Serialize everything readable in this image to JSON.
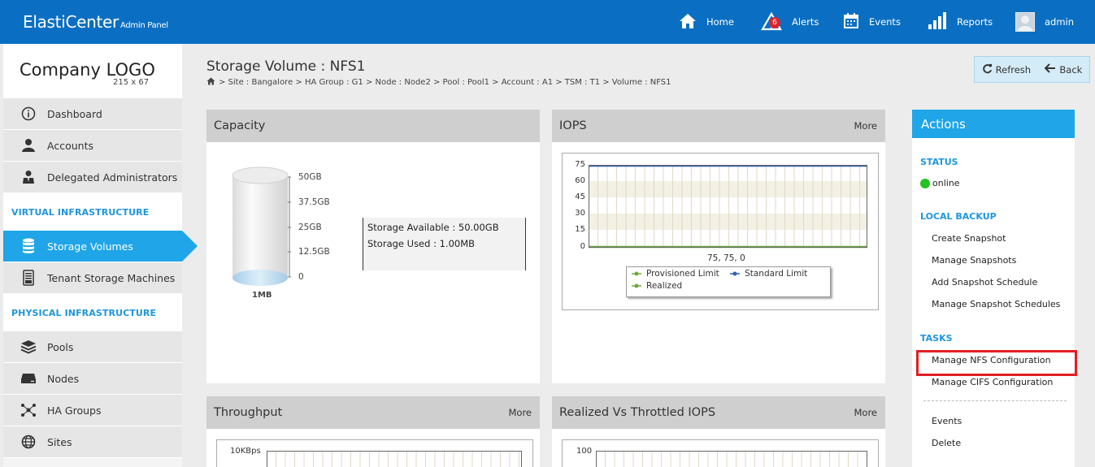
{
  "header": {
    "brand": "ElastiCenter",
    "brand_sub": "Admin Panel",
    "nav": [
      {
        "label": "Home",
        "icon": "home-icon"
      },
      {
        "label": "Alerts",
        "icon": "alert-icon",
        "badge": "6"
      },
      {
        "label": "Events",
        "icon": "calendar-icon"
      },
      {
        "label": "Reports",
        "icon": "bar-chart-icon"
      },
      {
        "label": "admin",
        "icon": "avatar"
      }
    ]
  },
  "sidebar": {
    "logo_line1": "Company LOGO",
    "logo_line2": "215 x 67",
    "items_top": [
      {
        "label": "Dashboard"
      },
      {
        "label": "Accounts"
      },
      {
        "label": "Delegated Administrators"
      }
    ],
    "section_virtual": "VIRTUAL INFRASTRUCTURE",
    "items_virtual": [
      {
        "label": "Storage Volumes",
        "active": true
      },
      {
        "label": "Tenant Storage Machines"
      }
    ],
    "section_physical": "PHYSICAL INFRASTRUCTURE",
    "items_physical": [
      {
        "label": "Pools"
      },
      {
        "label": "Nodes"
      },
      {
        "label": "HA Groups"
      },
      {
        "label": "Sites"
      }
    ]
  },
  "page": {
    "title": "Storage Volume : NFS1",
    "breadcrumb": "> Site : Bangalore > HA Group : G1 > Node : Node2 > Pool : Pool1 > Account : A1 > TSM : T1 > Volume : NFS1",
    "refresh_label": "Refresh",
    "back_label": "Back"
  },
  "capacity": {
    "title": "Capacity",
    "scale": [
      "50GB",
      "37.5GB",
      "25GB",
      "12.5GB",
      "0"
    ],
    "fill_label": "1MB",
    "available": "Storage Available : 50.00GB",
    "used": "Storage Used : 1.00MB"
  },
  "iops": {
    "title": "IOPS",
    "more": "More",
    "y_ticks": [
      "75",
      "60",
      "45",
      "30",
      "15",
      "0"
    ],
    "readout": "75, 75, 0",
    "legend": [
      {
        "name": "Provisioned Limit",
        "color": "#6aaa3a"
      },
      {
        "name": "Standard Limit",
        "color": "#2d5fb5"
      },
      {
        "name": "Realized",
        "color": "#6aaa3a"
      }
    ]
  },
  "throughput": {
    "title": "Throughput",
    "more": "More",
    "y_top": "10KBps"
  },
  "realized": {
    "title": "Realized Vs Throttled IOPS",
    "more": "More",
    "y_top": "100"
  },
  "actions": {
    "title": "Actions",
    "status_label": "STATUS",
    "status_value": "online",
    "local_backup_label": "LOCAL BACKUP",
    "backup_links": [
      "Create Snapshot",
      "Manage Snapshots",
      "Add Snapshot Schedule",
      "Manage Snapshot Schedules"
    ],
    "tasks_label": "TASKS",
    "task_links": [
      "Manage NFS Configuration",
      "Manage CIFS Configuration"
    ],
    "other_links": [
      "Events",
      "Delete"
    ]
  },
  "colors": {
    "topbar": "#0a6fc2",
    "accent": "#1fa5e8",
    "highlight": "#e31e24",
    "online": "#22c322"
  }
}
